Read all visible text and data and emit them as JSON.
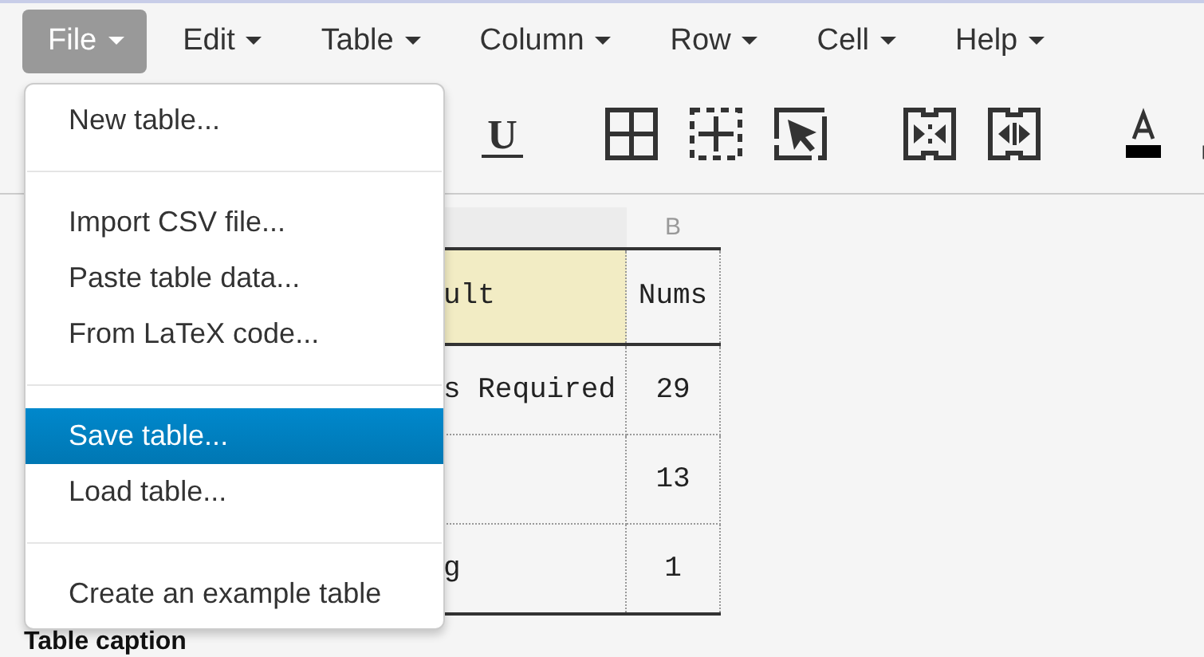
{
  "menubar": [
    {
      "label": "File",
      "selected": true
    },
    {
      "label": "Edit",
      "selected": false
    },
    {
      "label": "Table",
      "selected": false
    },
    {
      "label": "Column",
      "selected": false
    },
    {
      "label": "Row",
      "selected": false
    },
    {
      "label": "Cell",
      "selected": false
    },
    {
      "label": "Help",
      "selected": false
    }
  ],
  "file_menu": {
    "items": [
      {
        "kind": "item",
        "label": "New table...",
        "selected": false
      },
      {
        "kind": "divider"
      },
      {
        "kind": "item",
        "label": "Import CSV file...",
        "selected": false
      },
      {
        "kind": "item",
        "label": "Paste table data...",
        "selected": false
      },
      {
        "kind": "item",
        "label": "From LaTeX code...",
        "selected": false
      },
      {
        "kind": "divider"
      },
      {
        "kind": "item",
        "label": "Save table...",
        "selected": true
      },
      {
        "kind": "item",
        "label": "Load table...",
        "selected": false
      },
      {
        "kind": "divider"
      },
      {
        "kind": "item",
        "label": "Create an example table",
        "selected": false
      }
    ]
  },
  "table": {
    "column_headers": [
      "B"
    ],
    "rows": [
      {
        "cells": [
          {
            "text": "ult",
            "highlighted": true
          },
          {
            "text": "Nums",
            "highlighted": false
          }
        ]
      },
      {
        "cells": [
          {
            "text": "s Required",
            "highlighted": false
          },
          {
            "text": "29",
            "highlighted": false
          }
        ]
      },
      {
        "cells": [
          {
            "highlighted": false
          },
          {
            "text": "13",
            "highlighted": false
          }
        ]
      },
      {
        "cells": [
          {
            "text": "g",
            "highlighted": false
          },
          {
            "text": "1",
            "highlighted": false
          }
        ]
      }
    ]
  },
  "toolbar": {
    "underline_glyph": "U"
  },
  "caption_label": "Table caption"
}
